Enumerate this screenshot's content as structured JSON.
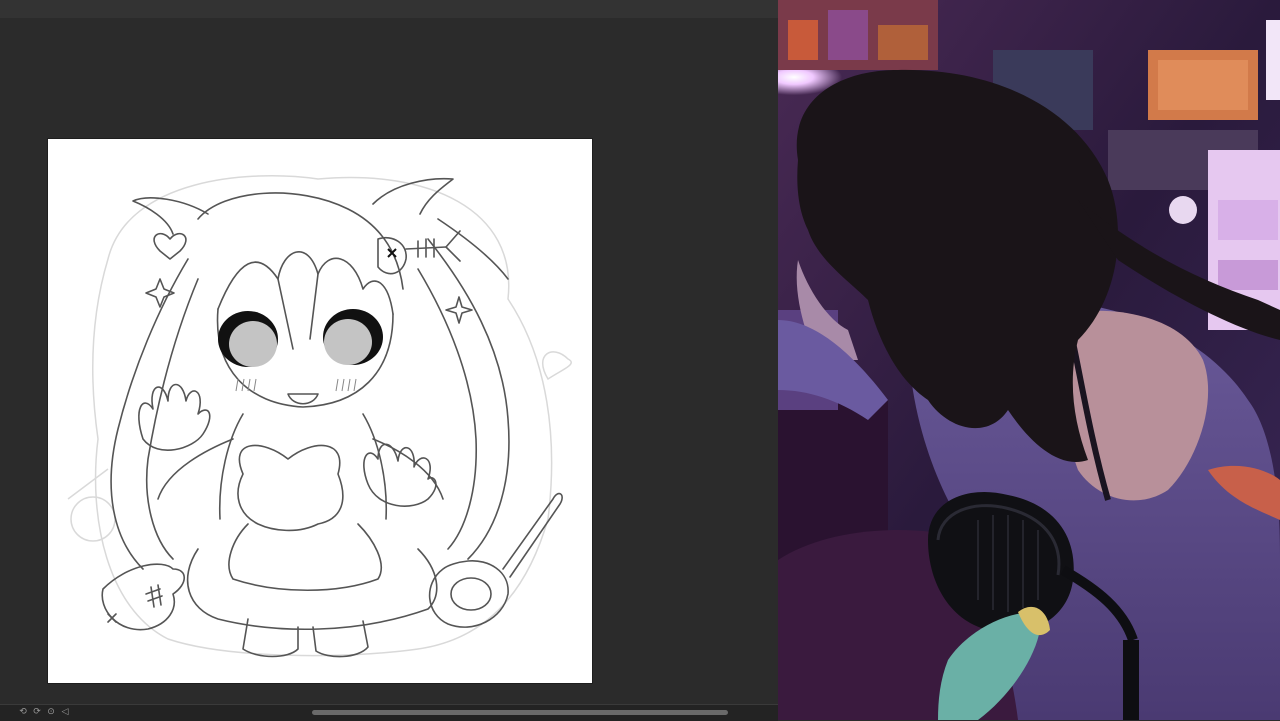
{
  "app": {
    "bottom_bar": {
      "zoom_label": "",
      "icons": [
        "rotate-left-icon",
        "rotate-right-icon",
        "reset-rotation-icon",
        "flip-icon"
      ]
    },
    "canvas": {
      "artwork": "chibi-girl-lineart"
    }
  },
  "webcam": {
    "content": "streamer-webcam-feed"
  },
  "colors": {
    "workspace": "#2b2b2b",
    "canvas": "#ffffff",
    "cam_accent": "#b070e8"
  }
}
